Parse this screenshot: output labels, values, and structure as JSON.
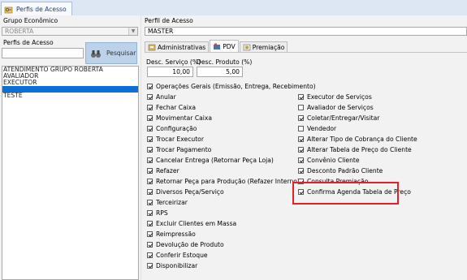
{
  "window": {
    "tab_title": "Perfis de Acesso",
    "tab_icon": "key-folder-icon"
  },
  "left": {
    "grupo_label": "Grupo Econômico",
    "grupo_value": "ROBERTA",
    "perfis_label": "Perfis de Acesso",
    "search_value": "",
    "search_button": "Pesquisar",
    "list": [
      {
        "label": "ATENDIMENTO GRUPO ROBERTA",
        "selected": false
      },
      {
        "label": "AVALIADOR",
        "selected": false
      },
      {
        "label": "EXECUTOR",
        "selected": false
      },
      {
        "label": "",
        "selected": true
      },
      {
        "label": "TESTE",
        "selected": false
      }
    ]
  },
  "right": {
    "perfil_label": "Perfil de Acesso",
    "perfil_value": "MASTER",
    "tabs": [
      {
        "label": "Administrativas",
        "icon": "admin-icon",
        "active": false
      },
      {
        "label": "PDV",
        "icon": "pdv-icon",
        "active": true
      },
      {
        "label": "Premiação",
        "icon": "premiacao-icon",
        "active": false
      }
    ],
    "desc_servico_label": "Desc. Serviço (%)",
    "desc_servico_value": "10,00",
    "desc_produto_label": "Desc. Produto (%)",
    "desc_produto_value": "5,00",
    "left_column": [
      {
        "label": "Operações Gerais (Emissão, Entrega, Recebimento)",
        "checked": true
      },
      {
        "label": "Anular",
        "checked": true
      },
      {
        "label": "Fechar Caixa",
        "checked": true
      },
      {
        "label": "Movimentar Caixa",
        "checked": true
      },
      {
        "label": "Configuração",
        "checked": true
      },
      {
        "label": "Trocar Executor",
        "checked": true
      },
      {
        "label": "Trocar Pagamento",
        "checked": true
      },
      {
        "label": "Cancelar Entrega (Retornar Peça Loja)",
        "checked": true
      },
      {
        "label": "Refazer",
        "checked": true
      },
      {
        "label": "Retornar Peça para Produção (Refazer Interno)",
        "checked": true
      },
      {
        "label": "Diversos Peça/Serviço",
        "checked": true
      },
      {
        "label": "Terceirizar",
        "checked": true
      },
      {
        "label": "RPS",
        "checked": true
      },
      {
        "label": "Excluir Clientes em Massa",
        "checked": true
      },
      {
        "label": "Reimpressão",
        "checked": true
      },
      {
        "label": "Devolução de Produto",
        "checked": true
      },
      {
        "label": "Conferir Estoque",
        "checked": true
      },
      {
        "label": "Disponibilizar",
        "checked": true
      }
    ],
    "right_column": [
      {
        "label": "Executor de Serviços",
        "checked": true
      },
      {
        "label": "Avaliador de Serviços",
        "checked": false
      },
      {
        "label": "Coletar/Entregar/Visitar",
        "checked": true
      },
      {
        "label": "Vendedor",
        "checked": false
      },
      {
        "label": "Alterar Tipo de Cobrança do Cliente",
        "checked": true
      },
      {
        "label": "Alterar Tabela de Preço do Cliente",
        "checked": true
      },
      {
        "label": "Convênio Cliente",
        "checked": true
      },
      {
        "label": "Desconto Padrão Cliente",
        "checked": true
      },
      {
        "label": "Consulta Premiação",
        "checked": true
      },
      {
        "label": "Confirma Agenda Tabela de Preço",
        "checked": true
      }
    ],
    "highlight_color": "#e5202a"
  }
}
